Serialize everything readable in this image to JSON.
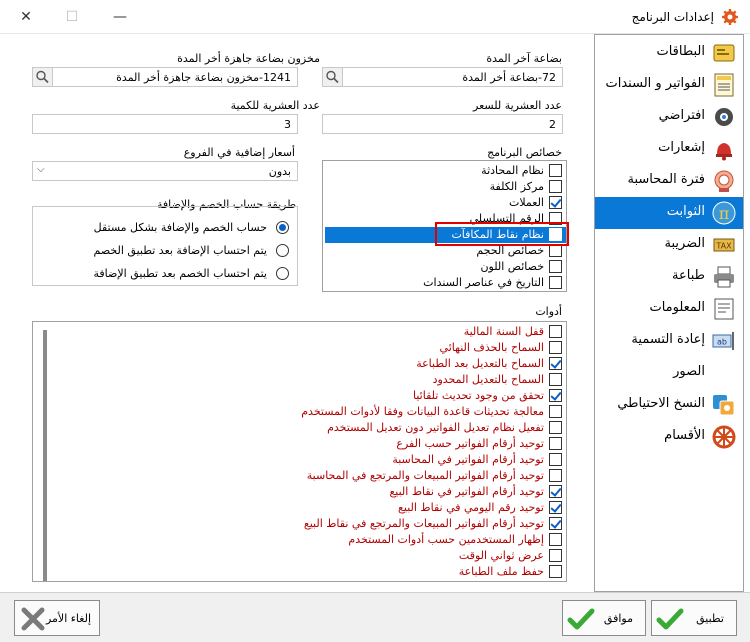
{
  "window": {
    "title": "إعدادات البرنامج",
    "close_glyph": "✕",
    "maximize_glyph": "☐",
    "minimize_glyph": "—"
  },
  "sidebar": {
    "items": [
      {
        "label": "البطاقات",
        "icon": "cards-icon"
      },
      {
        "label": "الفواتير و السندات",
        "icon": "bills-icon"
      },
      {
        "label": "افتراضي",
        "icon": "default-gear-icon"
      },
      {
        "label": "إشعارات",
        "icon": "bell-icon"
      },
      {
        "label": "فترة المحاسبة",
        "icon": "period-icon"
      },
      {
        "label": "الثوابت",
        "icon": "pi-icon"
      },
      {
        "label": "الضريبة",
        "icon": "tax-icon"
      },
      {
        "label": "طباعة",
        "icon": "printer-icon"
      },
      {
        "label": "المعلومات",
        "icon": "info-icon"
      },
      {
        "label": "إعادة التسمية",
        "icon": "rename-icon"
      },
      {
        "label": "الصور",
        "icon": "images-icon"
      },
      {
        "label": "النسخ الاحتياطي",
        "icon": "backup-icon"
      },
      {
        "label": "الأقسام",
        "icon": "sections-wheel-icon"
      }
    ],
    "active_index": 5,
    "active_color": "#0a78d7"
  },
  "form": {
    "last_period_goods_label": "بضاعة آخر المدة",
    "last_period_goods_value": "72-بضاعة أخر المدة",
    "finished_goods_stock_label": "مخزون بضاعة جاهزة أخر المدة",
    "finished_goods_stock_value": "1241-مخزون بضاعة جاهزة أخر المدة",
    "price_decimals_label": "عدد العشرية للسعر",
    "price_decimals_value": "2",
    "qty_decimals_label": "عدد العشرية للكمية",
    "qty_decimals_value": "3",
    "branch_prices_label": "أسعار إضافية في الفروع",
    "branch_prices_value": "بدون",
    "discount_method_label": "طريقة حساب الخصم والإضافة",
    "discount_options": [
      {
        "label": "حساب الخصم والإضافة بشكل مستقل",
        "selected": true
      },
      {
        "label": "يتم احتساب الإضافة بعد تطبيق الخصم",
        "selected": false
      },
      {
        "label": "يتم احتساب الخصم بعد تطبيق الإضافة",
        "selected": false
      }
    ]
  },
  "properties": {
    "label": "خصائص البرنامج",
    "items": [
      {
        "label": "نظام المحادثة",
        "checked": false
      },
      {
        "label": "مركز الكلفة",
        "checked": false
      },
      {
        "label": "العملات",
        "checked": true
      },
      {
        "label": "الرقم التسلسلي",
        "checked": false
      },
      {
        "label": "نظام نقاط المكافآت",
        "checked": true
      },
      {
        "label": "خصائص الحجم",
        "checked": false
      },
      {
        "label": "خصائص اللون",
        "checked": false
      },
      {
        "label": "التاريخ في عناصر السندات",
        "checked": false
      }
    ],
    "highlighted_index": 4
  },
  "tools": {
    "label": "أدوات",
    "items": [
      {
        "label": "قفل السنة المالية",
        "checked": false
      },
      {
        "label": "السماح بالحذف النهائي",
        "checked": false
      },
      {
        "label": "السماح بالتعديل بعد الطباعة",
        "checked": true
      },
      {
        "label": "السماح بالتعديل المحدود",
        "checked": false
      },
      {
        "label": "تحقق من وجود تحديث تلقائيا",
        "checked": true
      },
      {
        "label": "معالجة تحديثات قاعدة البيانات وفقا لأدوات المستخدم",
        "checked": false
      },
      {
        "label": "تفعيل نظام تعديل الفواتير دون تعديل المستخدم",
        "checked": false
      },
      {
        "label": "توحيد أرقام الفواتير حسب الفرع",
        "checked": false
      },
      {
        "label": "توحيد أرقام الفواتير في المحاسبة",
        "checked": false
      },
      {
        "label": "توحيد أرقام الفواتير المبيعات والمرتجع في المحاسبة",
        "checked": false
      },
      {
        "label": "توحيد أرقام الفواتير في نقاط البيع",
        "checked": true
      },
      {
        "label": "توحيد رقم اليومي في نقاط البيع",
        "checked": true
      },
      {
        "label": "توحيد أرقام الفواتير المبيعات والمرتجع في نقاط البيع",
        "checked": true
      },
      {
        "label": "إظهار المستخدمين حسب أدوات المستخدم",
        "checked": false
      },
      {
        "label": "عرض ثواني الوقت",
        "checked": false
      },
      {
        "label": "حفظ ملف الطباعة",
        "checked": false
      }
    ]
  },
  "buttons": {
    "apply": "تطبيق",
    "ok": "موافق",
    "cancel": "إلغاء الأمر"
  },
  "colors": {
    "accent": "#0a78d7",
    "tool_text": "#b00000",
    "highlight_border": "#e00000"
  }
}
